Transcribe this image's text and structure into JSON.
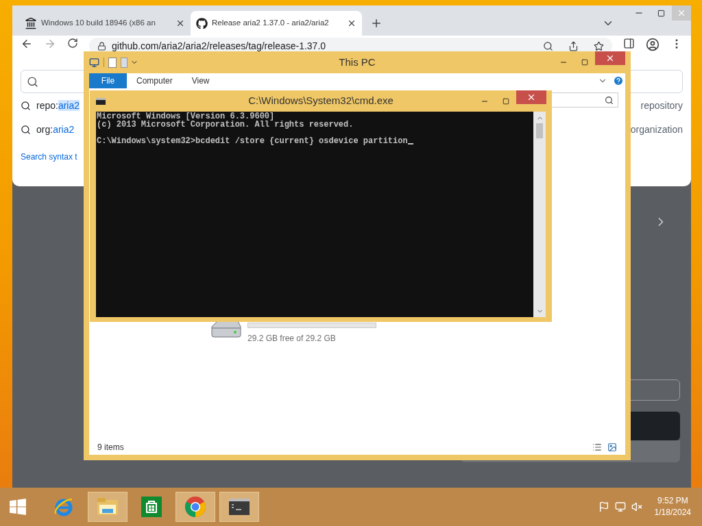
{
  "browser": {
    "tabs": [
      {
        "title": "Windows 10 build 18946 (x86 an",
        "selected": false
      },
      {
        "title": "Release aria2 1.37.0 - aria2/aria2",
        "selected": true
      }
    ],
    "address": "github.com/aria2/aria2/releases/tag/release-1.37.0",
    "suggestions": [
      {
        "prefix": "repo:",
        "term": "aria2",
        "scope": "repository",
        "highlighted": true
      },
      {
        "prefix": "org:",
        "term": "aria2",
        "scope": "organization",
        "highlighted": false
      }
    ],
    "footer_link": "Search syntax t"
  },
  "explorer": {
    "title": "This PC",
    "ribbon_tabs": [
      {
        "label": "File",
        "kind": "file"
      },
      {
        "label": "Computer",
        "kind": "tab"
      },
      {
        "label": "View",
        "kind": "tab"
      }
    ],
    "drive": {
      "free": "29.2 GB free of 29.2 GB",
      "level": 0
    },
    "status": "9 items"
  },
  "console": {
    "title": "C:\\Windows\\System32\\cmd.exe",
    "lines": [
      "Microsoft Windows [Version 6.3.9600]",
      "(c) 2013 Microsoft Corporation. All rights reserved."
    ],
    "prompt": "C:\\Windows\\system32>bcdedit /store {current} osdevice partition",
    "cursor": true
  },
  "taskbar": {
    "apps": [
      {
        "kind": "ie",
        "active": false
      },
      {
        "kind": "explorer",
        "active": true
      },
      {
        "kind": "store",
        "active": false
      },
      {
        "kind": "chrome",
        "active": true
      },
      {
        "kind": "cmd",
        "active": true
      }
    ],
    "time": "9:52 PM",
    "date": "1/18/2024"
  }
}
